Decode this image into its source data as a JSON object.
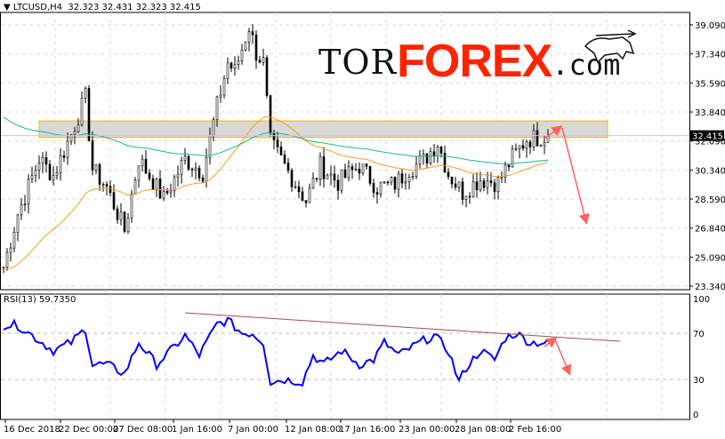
{
  "header": {
    "symbol": "LTCUSD,H4",
    "ohlc": "32.323 32.431 32.323 32.415"
  },
  "rsi_header": "RSI(13) 59.7350",
  "logo": {
    "tor": "TOR",
    "forex": "FOREX",
    "com": ".com"
  },
  "colors": {
    "up": "#000000",
    "ma_fast": "#f0a020",
    "ma_slow": "#20b0a0",
    "rsi": "#0000ff",
    "trend": "#a05050",
    "arrow": "#ff6060",
    "zone_border": "#f5b800"
  },
  "chart_data": [
    {
      "type": "candlestick",
      "title": "LTCUSD,H4",
      "ylim": [
        23.34,
        39.09
      ],
      "y_ticks": [
        "39.090",
        "37.340",
        "35.590",
        "33.840",
        "32.090",
        "30.340",
        "28.590",
        "26.840",
        "25.090",
        "23.340"
      ],
      "current_price": "32.415",
      "x_ticks": [
        "16 Dec 2018",
        "22 Dec 00:00",
        "27 Dec 08:00",
        "1 Jan 16:00",
        "7 Jan 00:00",
        "12 Jan 08:00",
        "17 Jan 16:00",
        "23 Jan 00:00",
        "28 Jan 08:00",
        "2 Feb 16:00"
      ],
      "close_path": [
        [
          1,
          24.5
        ],
        [
          5,
          27.7
        ],
        [
          11,
          31
        ],
        [
          15,
          30
        ],
        [
          20,
          32.5
        ],
        [
          24,
          34.7
        ],
        [
          26,
          30.4
        ],
        [
          30,
          29.3
        ],
        [
          35,
          26.7
        ],
        [
          39,
          31
        ],
        [
          42,
          30
        ],
        [
          46,
          28.6
        ],
        [
          52,
          31
        ],
        [
          57,
          30.2
        ],
        [
          61,
          34.2
        ],
        [
          64,
          36.8
        ],
        [
          66,
          36.3
        ],
        [
          70,
          39
        ],
        [
          72,
          37.4
        ],
        [
          74,
          36.8
        ],
        [
          76,
          32
        ],
        [
          80,
          30.6
        ],
        [
          86,
          28.5
        ],
        [
          90,
          30.6
        ],
        [
          95,
          29.6
        ],
        [
          101,
          30.6
        ],
        [
          106,
          29.3
        ],
        [
          111,
          29.5
        ],
        [
          115,
          30.4
        ],
        [
          119,
          30.9
        ],
        [
          123,
          32
        ],
        [
          126,
          30.1
        ],
        [
          130,
          29
        ],
        [
          135,
          29.8
        ],
        [
          140,
          29.6
        ],
        [
          144,
          31.1
        ],
        [
          148,
          32.2
        ],
        [
          154,
          32.4
        ]
      ],
      "resistance_zone": [
        32.3,
        33.3
      ]
    },
    {
      "type": "line",
      "title": "RSI(13) 59.7350",
      "ylim": [
        0,
        100
      ],
      "y_ticks": [
        "100",
        "70",
        "30",
        "0"
      ],
      "values": [
        [
          1,
          77
        ],
        [
          5,
          77
        ],
        [
          10,
          66
        ],
        [
          15,
          55
        ],
        [
          20,
          62
        ],
        [
          24,
          74
        ],
        [
          26,
          43
        ],
        [
          30,
          43
        ],
        [
          35,
          35
        ],
        [
          39,
          62
        ],
        [
          44,
          43
        ],
        [
          48,
          55
        ],
        [
          52,
          68
        ],
        [
          56,
          51
        ],
        [
          61,
          78
        ],
        [
          64,
          81
        ],
        [
          68,
          70
        ],
        [
          71,
          70
        ],
        [
          74,
          62
        ],
        [
          76,
          28
        ],
        [
          80,
          30
        ],
        [
          85,
          28
        ],
        [
          88,
          51
        ],
        [
          91,
          43
        ],
        [
          96,
          55
        ],
        [
          101,
          43
        ],
        [
          105,
          47
        ],
        [
          108,
          62
        ],
        [
          112,
          51
        ],
        [
          118,
          62
        ],
        [
          122,
          68
        ],
        [
          126,
          55
        ],
        [
          129,
          28
        ],
        [
          131,
          40
        ],
        [
          135,
          55
        ],
        [
          139,
          47
        ],
        [
          142,
          66
        ],
        [
          145,
          70
        ],
        [
          149,
          62
        ],
        [
          154,
          62
        ]
      ]
    }
  ]
}
